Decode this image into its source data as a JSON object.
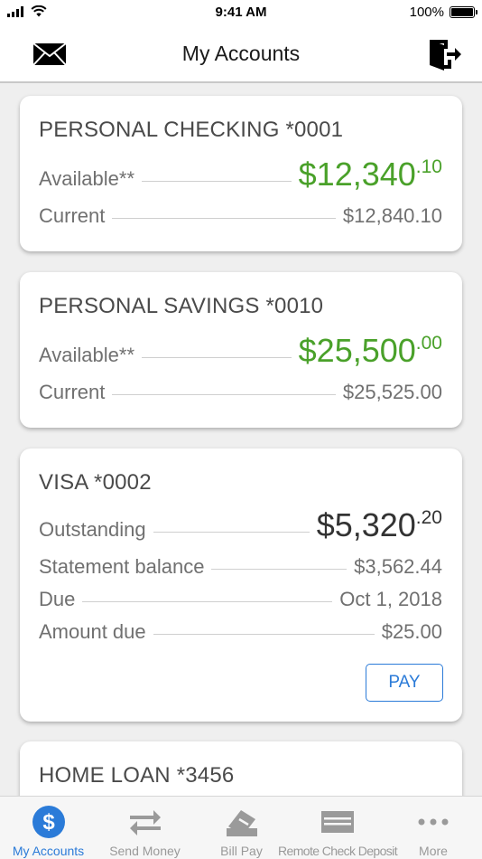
{
  "status_bar": {
    "time": "9:41 AM",
    "battery": "100%"
  },
  "header": {
    "title": "My Accounts",
    "left_icon": "mail-icon",
    "right_icon": "logout-icon"
  },
  "accounts": [
    {
      "name": "PERSONAL CHECKING",
      "number": "*0001",
      "primary_label": "Available**",
      "primary_amount_main": "$12,340",
      "primary_amount_cents": ".10",
      "rows": [
        {
          "label": "Current",
          "value": "$12,840.10"
        }
      ]
    },
    {
      "name": "PERSONAL SAVINGS",
      "number": "*0010",
      "primary_label": "Available**",
      "primary_amount_main": "$25,500",
      "primary_amount_cents": ".00",
      "rows": [
        {
          "label": "Current",
          "value": "$25,525.00"
        }
      ]
    },
    {
      "name": "VISA",
      "number": "*0002",
      "primary_label": "Outstanding",
      "primary_amount_main": "$5,320",
      "primary_amount_cents": ".20",
      "rows": [
        {
          "label": "Statement balance",
          "value": "$3,562.44"
        },
        {
          "label": "Due",
          "value": "Oct 1, 2018"
        },
        {
          "label": "Amount due",
          "value": "$25.00"
        }
      ],
      "action_label": "PAY"
    },
    {
      "name": "HOME LOAN",
      "number": "*3456"
    }
  ],
  "colors": {
    "accent": "#2b7bd8",
    "positive_amount": "#4aa12a",
    "neutral_amount": "#333333"
  },
  "tabs": [
    {
      "label": "My Accounts",
      "icon": "dollar-icon",
      "active": true
    },
    {
      "label": "Send Money",
      "icon": "transfer-arrows-icon",
      "active": false
    },
    {
      "label": "Bill Pay",
      "icon": "bill-pay-icon",
      "active": false
    },
    {
      "label": "Remote Check Deposit",
      "icon": "check-deposit-icon",
      "active": false
    },
    {
      "label": "More",
      "icon": "more-dots-icon",
      "active": false
    }
  ]
}
